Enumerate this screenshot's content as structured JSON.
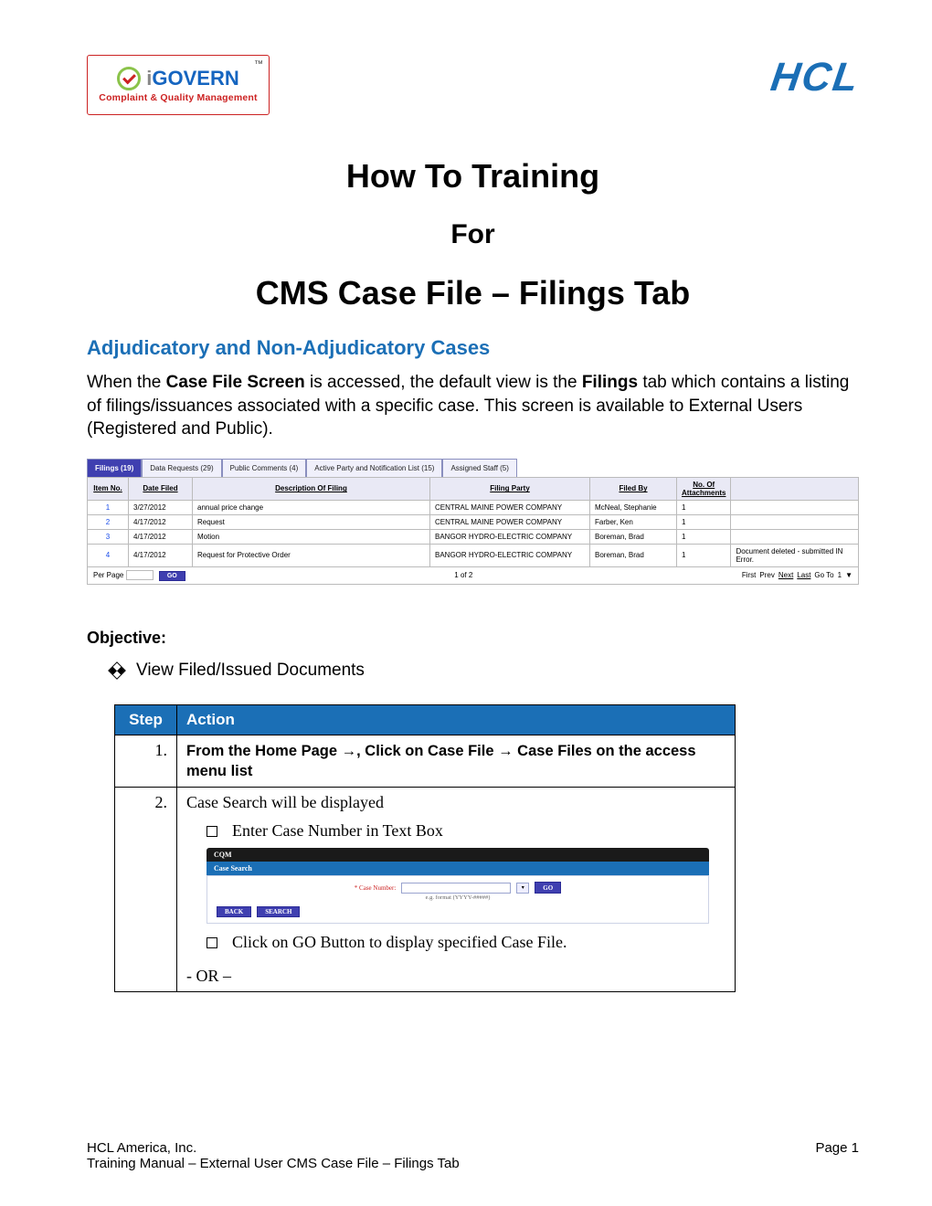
{
  "logos": {
    "igovern": {
      "brand_prefix": "i",
      "brand": "GOVERN",
      "tm": "™",
      "subtitle": "Complaint & Quality Management"
    },
    "hcl": "HCL"
  },
  "title": {
    "line1": "How To Training",
    "line2": "For",
    "line3": "CMS Case File – Filings Tab"
  },
  "section_heading": "Adjudicatory and Non-Adjudicatory Cases",
  "intro_text_pre": "When the ",
  "intro_text_b1": "Case File Screen",
  "intro_text_mid": " is accessed, the default view is the ",
  "intro_text_b2": "Filings",
  "intro_text_post": " tab which contains a listing of filings/issuances associated with a specific case.  This screen is available to External Users (Registered and Public).",
  "tabs": [
    {
      "label": "Filings (19)",
      "active": true
    },
    {
      "label": "Data Requests (29)"
    },
    {
      "label": "Public Comments (4)"
    },
    {
      "label": "Active Party and Notification List (15)"
    },
    {
      "label": "Assigned Staff (5)"
    }
  ],
  "filings": {
    "columns": [
      "Item No.",
      "Date Filed",
      "Description Of Filing",
      "Filing Party",
      "Filed By",
      "No. Of Attachments",
      ""
    ],
    "rows": [
      {
        "n": "1",
        "date": "3/27/2012",
        "desc": "annual price change",
        "party": "CENTRAL MAINE POWER COMPANY",
        "by": "McNeal, Stephanie",
        "att": "1",
        "note": ""
      },
      {
        "n": "2",
        "date": "4/17/2012",
        "desc": "Request",
        "party": "CENTRAL MAINE POWER COMPANY",
        "by": "Farber, Ken",
        "att": "1",
        "note": ""
      },
      {
        "n": "3",
        "date": "4/17/2012",
        "desc": "Motion",
        "party": "BANGOR HYDRO-ELECTRIC COMPANY",
        "by": "Boreman, Brad",
        "att": "1",
        "note": ""
      },
      {
        "n": "4",
        "date": "4/17/2012",
        "desc": "Request for Protective Order",
        "party": "BANGOR HYDRO-ELECTRIC COMPANY",
        "by": "Boreman, Brad",
        "att": "1",
        "note": "Document deleted - submitted IN Error."
      }
    ],
    "per_page_label": "Per Page",
    "go": "GO",
    "page_indicator": "1 of 2",
    "pager": {
      "first": "First",
      "prev": "Prev",
      "next": "Next",
      "last": "Last",
      "goto": "Go To",
      "goto_val": "1"
    }
  },
  "objective": {
    "heading": "Objective:",
    "items": [
      "View Filed/Issued Documents"
    ]
  },
  "steps": {
    "headers": {
      "step": "Step",
      "action": "Action"
    },
    "rows": [
      {
        "n": "1.",
        "body": {
          "bold": "From the Home Page →, Click on Case File → Case Files on the access menu list"
        }
      },
      {
        "n": "2.",
        "body": {
          "lead": "Case Search will be displayed",
          "bullets": [
            "Enter Case Number  in Text Box",
            "Click on GO Button to display specified Case File."
          ],
          "or": "- OR –"
        }
      }
    ]
  },
  "case_search": {
    "top": "CQM",
    "head": "Case Search",
    "label": "Case Number:",
    "format_hint": "e.g. format (YYYY-#####)",
    "go": "GO",
    "back": "BACK",
    "search": "SEARCH"
  },
  "footer": {
    "company": "HCL America, Inc.",
    "page_prefix": "Page ",
    "page_num": "1",
    "sub": "Training Manual – External User CMS Case File – Filings Tab"
  }
}
